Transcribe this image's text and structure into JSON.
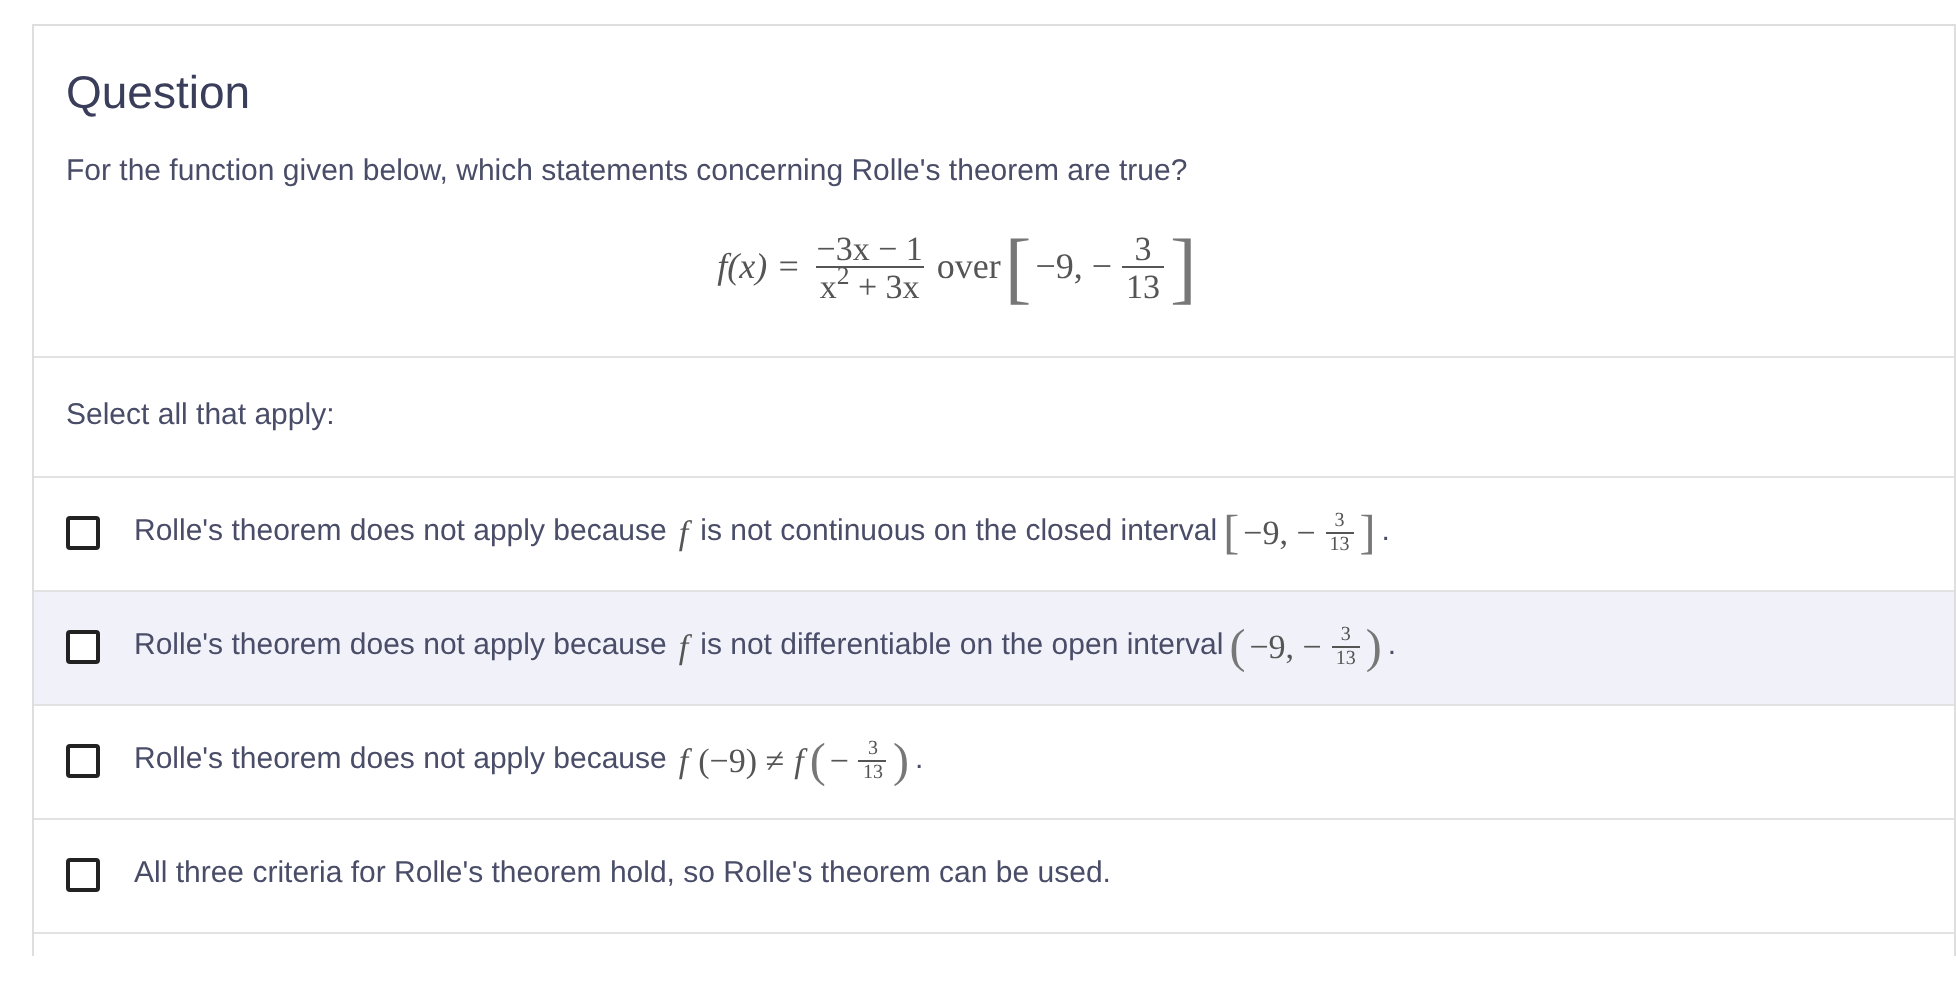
{
  "title": "Question",
  "prompt": "For the function given below, which statements concerning Rolle's theorem are true?",
  "formula": [
    {
      "kind": "math",
      "text": "f(x) ="
    },
    {
      "kind": "frac",
      "num": "−3x − 1",
      "den": "x$^{2}$ + 3x"
    },
    {
      "kind": "serif",
      "text": "over"
    },
    {
      "kind": "bracket",
      "text": "["
    },
    {
      "kind": "serif",
      "text": "−9, −"
    },
    {
      "kind": "frac",
      "num": "3",
      "den": "13"
    },
    {
      "kind": "bracket",
      "text": "]"
    }
  ],
  "instruction": "Select all that apply:",
  "options": [
    {
      "checked": false,
      "hovered": false,
      "parts": [
        {
          "kind": "text",
          "text": "Rolle's theorem does not apply because"
        },
        {
          "kind": "math",
          "text": "f"
        },
        {
          "kind": "text",
          "text": "is not continuous on the closed interval"
        },
        {
          "kind": "bracket",
          "text": "["
        },
        {
          "kind": "serif",
          "text": "−9, −"
        },
        {
          "kind": "frac",
          "num": "3",
          "den": "13"
        },
        {
          "kind": "bracket",
          "text": "]"
        },
        {
          "kind": "text",
          "text": "."
        }
      ]
    },
    {
      "checked": false,
      "hovered": true,
      "parts": [
        {
          "kind": "text",
          "text": "Rolle's theorem does not apply because"
        },
        {
          "kind": "math",
          "text": "f"
        },
        {
          "kind": "text",
          "text": "is not differentiable on the open interval"
        },
        {
          "kind": "bracket",
          "text": "("
        },
        {
          "kind": "serif",
          "text": "−9, −"
        },
        {
          "kind": "frac",
          "num": "3",
          "den": "13"
        },
        {
          "kind": "bracket",
          "text": ")"
        },
        {
          "kind": "text",
          "text": "."
        }
      ]
    },
    {
      "checked": false,
      "hovered": false,
      "parts": [
        {
          "kind": "text",
          "text": "Rolle's theorem does not apply because"
        },
        {
          "kind": "math",
          "text": "f"
        },
        {
          "kind": "serif",
          "text": "(−9) ≠"
        },
        {
          "kind": "math",
          "text": "f"
        },
        {
          "kind": "bracket",
          "text": "("
        },
        {
          "kind": "serif",
          "text": "−"
        },
        {
          "kind": "frac",
          "num": "3",
          "den": "13"
        },
        {
          "kind": "bracket",
          "text": ")"
        },
        {
          "kind": "text",
          "text": "."
        }
      ]
    },
    {
      "checked": false,
      "hovered": false,
      "parts": [
        {
          "kind": "text",
          "text": "All three criteria for Rolle's theorem hold, so Rolle's theorem can be used."
        }
      ]
    }
  ]
}
